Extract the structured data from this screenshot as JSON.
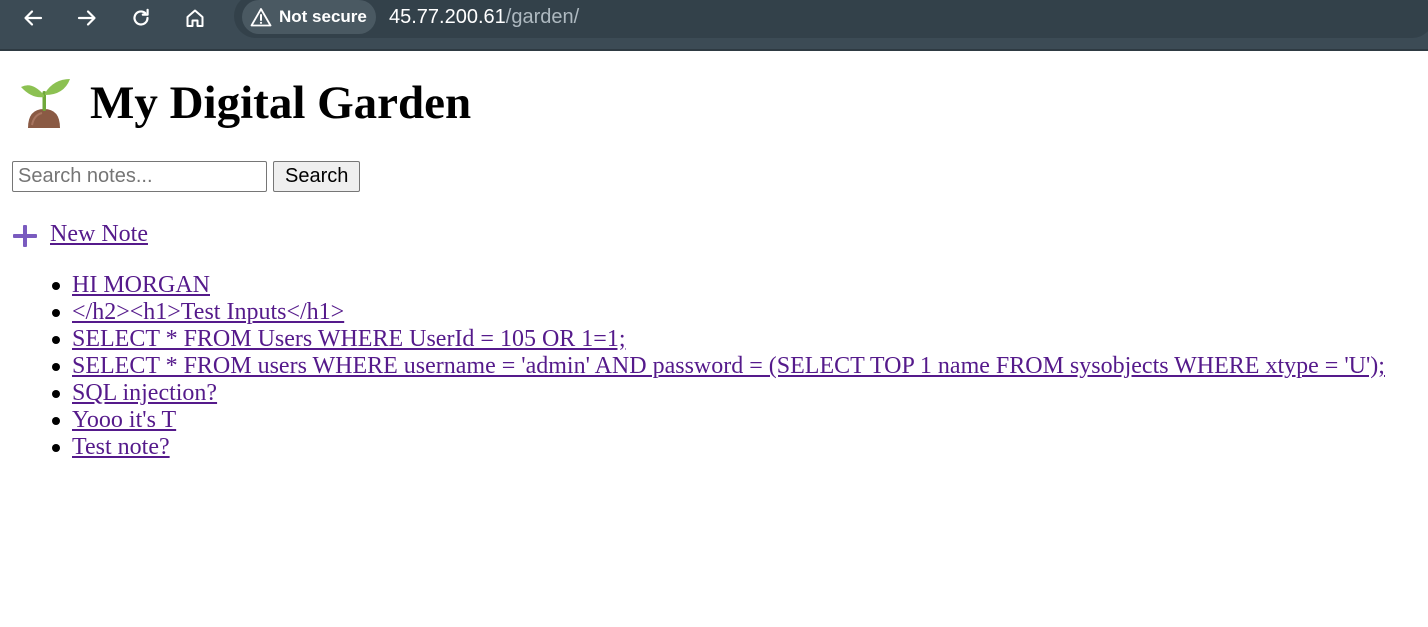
{
  "browser": {
    "security_label": "Not secure",
    "url_host": "45.77.200.61",
    "url_path": "/garden/"
  },
  "page": {
    "title": "My Digital Garden",
    "title_icon": "seedling-icon",
    "search": {
      "placeholder": "Search notes...",
      "value": "",
      "button_label": "Search"
    },
    "new_note_label": " New Note",
    "notes": [
      "HI MORGAN",
      "</h2><h1>Test Inputs</h1>",
      "SELECT * FROM Users WHERE UserId = 105 OR 1=1;",
      "SELECT * FROM users WHERE username = 'admin' AND password = (SELECT TOP 1 name FROM sysobjects WHERE xtype = 'U');",
      "SQL injection?",
      "Yooo it's T",
      "Test note?"
    ]
  },
  "colors": {
    "toolbar": "#3c4b55",
    "link_visited": "#551a8b",
    "plus_icon": "#7a5bbf"
  }
}
